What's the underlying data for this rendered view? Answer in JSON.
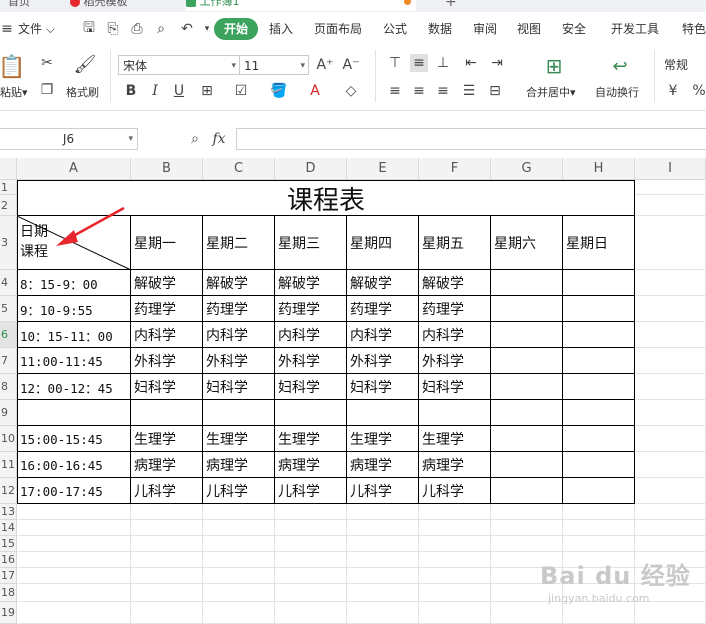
{
  "tabs": [
    {
      "label": "首页",
      "active": false
    },
    {
      "label": "稻壳模板",
      "active": false
    },
    {
      "label": "工作簿1",
      "active": true
    }
  ],
  "menu": {
    "file": "文件",
    "items": [
      "开始",
      "插入",
      "页面布局",
      "公式",
      "数据",
      "审阅",
      "视图",
      "安全",
      "开发工具",
      "特色"
    ]
  },
  "ribbon": {
    "paste": "粘贴",
    "format_painter": "格式刷",
    "font_name": "宋体",
    "font_size": "11",
    "merge_center": "合并居中",
    "wrap_text": "自动换行",
    "number_format": "常规"
  },
  "formula_bar": {
    "name_box": "J6",
    "fx": "fx",
    "value": ""
  },
  "grid": {
    "columns": [
      "A",
      "B",
      "C",
      "D",
      "E",
      "F",
      "G",
      "H",
      "I"
    ],
    "rows": [
      "1",
      "2",
      "3",
      "4",
      "5",
      "6",
      "7",
      "8",
      "9",
      "10",
      "11",
      "12",
      "13",
      "14",
      "15",
      "16",
      "17",
      "18",
      "19"
    ]
  },
  "sheet": {
    "title": "课程表",
    "corner_top": "日期",
    "corner_bottom": "课程",
    "days": [
      "星期一",
      "星期二",
      "星期三",
      "星期四",
      "星期五",
      "星期六",
      "星期日"
    ],
    "schedule": [
      {
        "time": "8：15-9：00",
        "courses": [
          "解破学",
          "解破学",
          "解破学",
          "解破学",
          "解破学",
          "",
          ""
        ]
      },
      {
        "time": "9：10-9:55",
        "courses": [
          "药理学",
          "药理学",
          "药理学",
          "药理学",
          "药理学",
          "",
          ""
        ]
      },
      {
        "time": "10：15-11：00",
        "courses": [
          "内科学",
          "内科学",
          "内科学",
          "内科学",
          "内科学",
          "",
          ""
        ]
      },
      {
        "time": "11:00-11:45",
        "courses": [
          "外科学",
          "外科学",
          "外科学",
          "外科学",
          "外科学",
          "",
          ""
        ]
      },
      {
        "time": "12：00-12：45",
        "courses": [
          "妇科学",
          "妇科学",
          "妇科学",
          "妇科学",
          "妇科学",
          "",
          ""
        ]
      },
      {
        "time": "",
        "courses": [
          "",
          "",
          "",
          "",
          "",
          "",
          ""
        ]
      },
      {
        "time": "15:00-15:45",
        "courses": [
          "生理学",
          "生理学",
          "生理学",
          "生理学",
          "生理学",
          "",
          ""
        ]
      },
      {
        "time": "16:00-16:45",
        "courses": [
          "病理学",
          "病理学",
          "病理学",
          "病理学",
          "病理学",
          "",
          ""
        ]
      },
      {
        "time": "17:00-17:45",
        "courses": [
          "儿科学",
          "儿科学",
          "儿科学",
          "儿科学",
          "儿科学",
          "",
          ""
        ]
      }
    ]
  },
  "watermark": {
    "brand": "Bai du 经验",
    "url": "jingyan.baidu.com"
  },
  "colors": {
    "accent": "#3ba35d",
    "arrow": "#e8262d",
    "active_tab_dot": "#f08a24"
  }
}
